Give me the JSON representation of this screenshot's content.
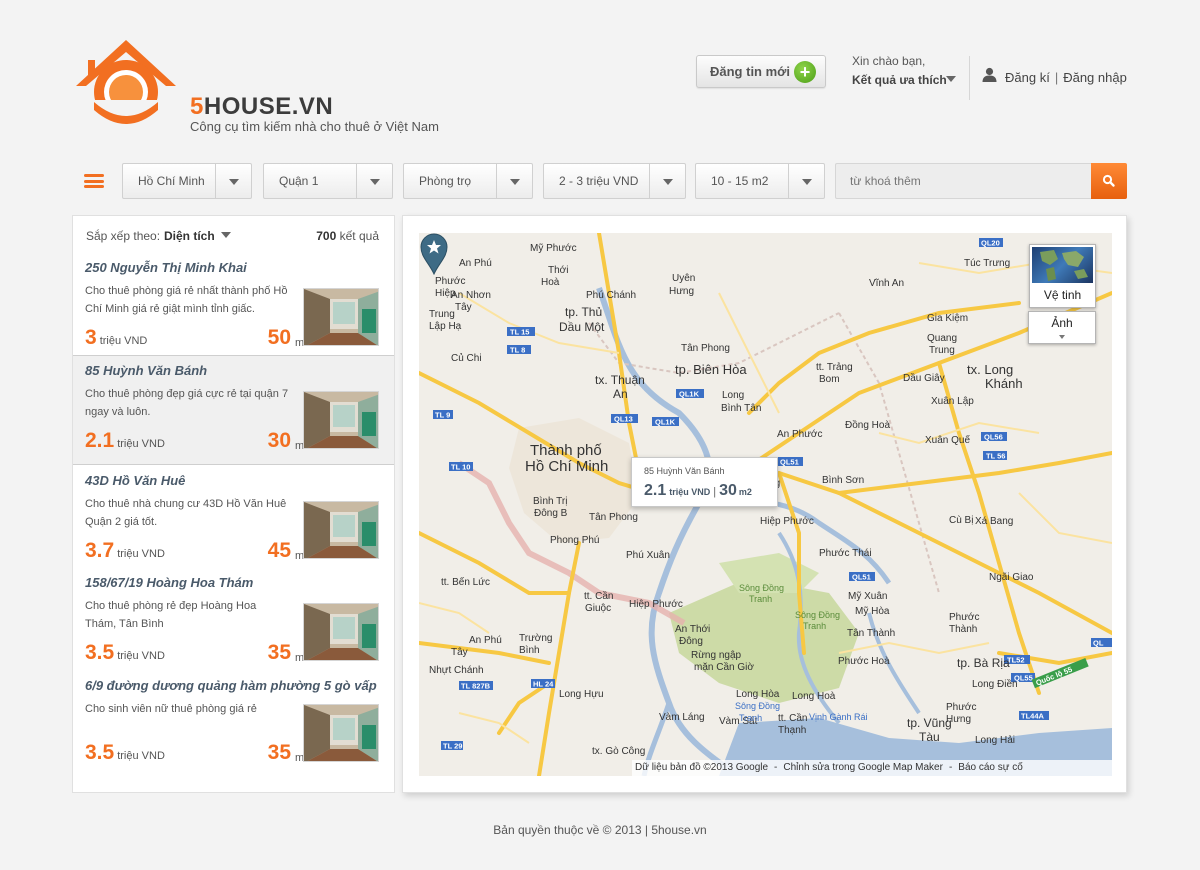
{
  "header": {
    "brand_prefix": "5",
    "brand_rest": "HOUSE.VN",
    "tagline": "Công cụ tìm kiếm nhà cho thuê ở Việt Nam",
    "post_button": "Đăng tin mới",
    "greeting": "Xin chào bạn,",
    "favorites": "Kết quả ưa thích",
    "register": "Đăng kí",
    "separator": "|",
    "login": "Đăng nhập"
  },
  "filters": {
    "city": "Hồ Chí Minh",
    "district": "Quận 1",
    "type": "Phòng trọ",
    "price": "2 - 3 triệu VND",
    "area": "10 - 15 m2",
    "keyword_placeholder": "từ khoá thêm"
  },
  "results": {
    "sort_label": "Sắp xếp theo:",
    "sort_value": "Diện tích",
    "count": "700",
    "count_label": "kết quả",
    "items": [
      {
        "title": "250 Nguyễn Thị Minh Khai",
        "desc": "Cho thuê phòng giá rẻ nhất thành phố Hồ Chí Minh giá rẻ giật mình tỉnh giấc.",
        "price": "3",
        "price_unit": "triệu VND",
        "area": "50",
        "area_unit": "m2"
      },
      {
        "title": "85 Huỳnh Văn Bánh",
        "desc": "Cho thuê phòng đẹp giá cực rẻ tại quận 7 ngay và luôn.",
        "price": "2.1",
        "price_unit": "triệu VND",
        "area": "30",
        "area_unit": "m2"
      },
      {
        "title": "43D Hồ Văn Huê",
        "desc": "Cho thuê nhà chung cư 43D Hồ Văn Huê Quận 2 giá tốt.",
        "price": "3.7",
        "price_unit": "triệu VND",
        "area": "45",
        "area_unit": "m2"
      },
      {
        "title": "158/67/19 Hoàng Hoa Thám",
        "desc": "Cho thuê phòng rẻ đẹp Hoàng Hoa Thám, Tân Bình",
        "price": "3.5",
        "price_unit": "triệu VND",
        "area": "35",
        "area_unit": "m2"
      },
      {
        "title": "6/9 đường dương quảng hàm phường 5 gò vấp",
        "desc": "Cho sinh viên nữ thuê phòng giá rẻ",
        "price": "3.5",
        "price_unit": "triệu VND",
        "area": "35",
        "area_unit": "m2"
      }
    ]
  },
  "map": {
    "satellite_label": "Vệ tinh",
    "photo_label": "Ảnh",
    "popup": {
      "title": "85 Huỳnh Văn Bánh",
      "price": "2.1",
      "price_unit": "triệu VND",
      "bar": "|",
      "area": "30",
      "area_unit": "m2"
    },
    "attribution": {
      "data": "Dữ liệu bản đồ ©2013 Google",
      "sep": "-",
      "edit": "Chỉnh sửa trong Google Map Maker",
      "report": "Báo cáo sự cố"
    }
  },
  "footer": {
    "text": "Bản quyền thuộc về © 2013 | 5house.vn"
  },
  "colors": {
    "accent": "#f26f21",
    "title_blue": "#4a5a6a",
    "map_bg": "#f1eee8",
    "water": "#a6bfdc",
    "park": "#cddba7",
    "road": "#f7c843"
  },
  "icons": [
    "house-logo-icon",
    "plus-icon",
    "user-icon",
    "menu-icon",
    "chevron-down-icon",
    "search-icon",
    "map-pin-icon",
    "star-icon"
  ]
}
